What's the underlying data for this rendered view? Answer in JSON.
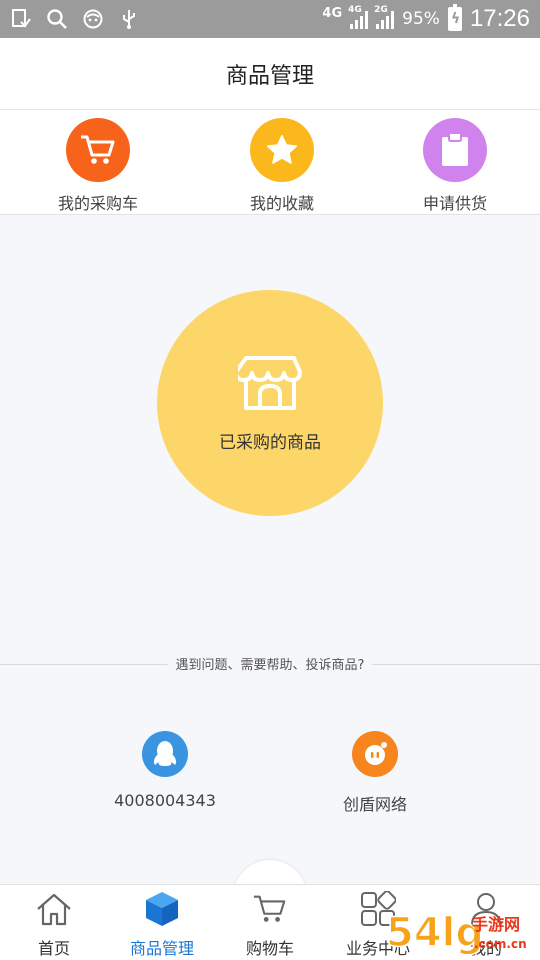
{
  "status_bar": {
    "network": "4G",
    "sim1_label": "4G",
    "sim2_label": "2G",
    "battery": "95%",
    "time": "17:26"
  },
  "header": {
    "title": "商品管理"
  },
  "quick_actions": [
    {
      "label": "我的采购车",
      "icon": "cart-icon",
      "color": "#f7631a"
    },
    {
      "label": "我的收藏",
      "icon": "star-icon",
      "color": "#fbb81c"
    },
    {
      "label": "申请供货",
      "icon": "clipboard-icon",
      "color": "#d083ec"
    }
  ],
  "main": {
    "purchased_label": "已采购的商品",
    "purchased_color": "#fdd66a",
    "help_text": "遇到问题、需要帮助、投诉商品?",
    "contacts": [
      {
        "label": "4008004343",
        "icon": "qq-icon",
        "color": "#3b94e0"
      },
      {
        "label": "创盾网络",
        "icon": "chat-bot-icon",
        "color": "#f7851e"
      }
    ]
  },
  "bottom_nav": {
    "items": [
      {
        "label": "首页",
        "icon": "home-icon"
      },
      {
        "label": "商品管理",
        "icon": "box-icon",
        "active": true
      },
      {
        "label": "购物车",
        "icon": "cart-icon"
      },
      {
        "label": "业务中心",
        "icon": "grid-icon"
      },
      {
        "label": "我的",
        "icon": "user-icon"
      }
    ],
    "active_color": "#1976d2"
  },
  "watermark": {
    "text": "54lg",
    "sub_text": "手游网",
    "domain": ".com.cn"
  }
}
